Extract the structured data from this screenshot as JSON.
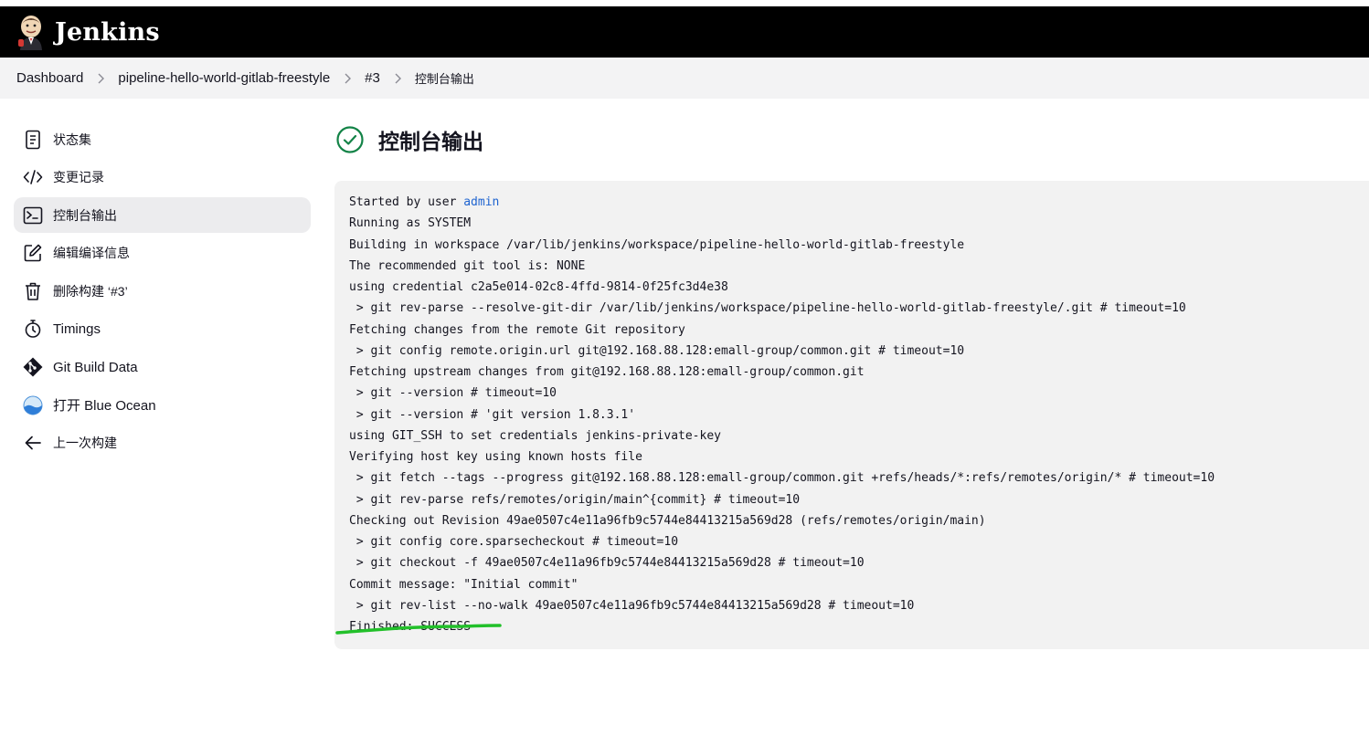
{
  "app": {
    "title": "Jenkins"
  },
  "breadcrumb": {
    "items": [
      "Dashboard",
      "pipeline-hello-world-gitlab-freestyle",
      "#3",
      "控制台输出"
    ]
  },
  "sidebar": {
    "items": [
      {
        "label": "状态集",
        "icon": "document-icon"
      },
      {
        "label": "变更记录",
        "icon": "code-icon"
      },
      {
        "label": "控制台输出",
        "icon": "terminal-icon",
        "active": true
      },
      {
        "label": "编辑编译信息",
        "icon": "edit-icon"
      },
      {
        "label": "删除构建 ‘#3’",
        "icon": "trash-icon"
      },
      {
        "label": "Timings",
        "icon": "stopwatch-icon"
      },
      {
        "label": "Git Build Data",
        "icon": "git-icon"
      },
      {
        "label": "打开 Blue Ocean",
        "icon": "blue-ocean-icon"
      },
      {
        "label": "上一次构建",
        "icon": "arrow-left-icon"
      }
    ]
  },
  "main": {
    "title": "控制台输出",
    "status": "success",
    "console": {
      "user_prefix": "Started by user ",
      "user_link": "admin",
      "lines": [
        "Running as SYSTEM",
        "Building in workspace /var/lib/jenkins/workspace/pipeline-hello-world-gitlab-freestyle",
        "The recommended git tool is: NONE",
        "using credential c2a5e014-02c8-4ffd-9814-0f25fc3d4e38",
        " > git rev-parse --resolve-git-dir /var/lib/jenkins/workspace/pipeline-hello-world-gitlab-freestyle/.git # timeout=10",
        "Fetching changes from the remote Git repository",
        " > git config remote.origin.url git@192.168.88.128:emall-group/common.git # timeout=10",
        "Fetching upstream changes from git@192.168.88.128:emall-group/common.git",
        " > git --version # timeout=10",
        " > git --version # 'git version 1.8.3.1'",
        "using GIT_SSH to set credentials jenkins-private-key",
        "Verifying host key using known hosts file",
        " > git fetch --tags --progress git@192.168.88.128:emall-group/common.git +refs/heads/*:refs/remotes/origin/* # timeout=10",
        " > git rev-parse refs/remotes/origin/main^{commit} # timeout=10",
        "Checking out Revision 49ae0507c4e11a96fb9c5744e84413215a569d28 (refs/remotes/origin/main)",
        " > git config core.sparsecheckout # timeout=10",
        " > git checkout -f 49ae0507c4e11a96fb9c5744e84413215a569d28 # timeout=10",
        "Commit message: \"Initial commit\"",
        " > git rev-list --no-walk 49ae0507c4e11a96fb9c5744e84413215a569d28 # timeout=10",
        "Finished: SUCCESS"
      ]
    }
  },
  "colors": {
    "header_bg": "#000000",
    "breadcrumb_bg": "#f3f3f4",
    "console_bg": "#f2f2f2",
    "success": "#138347",
    "link": "#1f64d0",
    "highlight_stroke": "#22c02a"
  }
}
